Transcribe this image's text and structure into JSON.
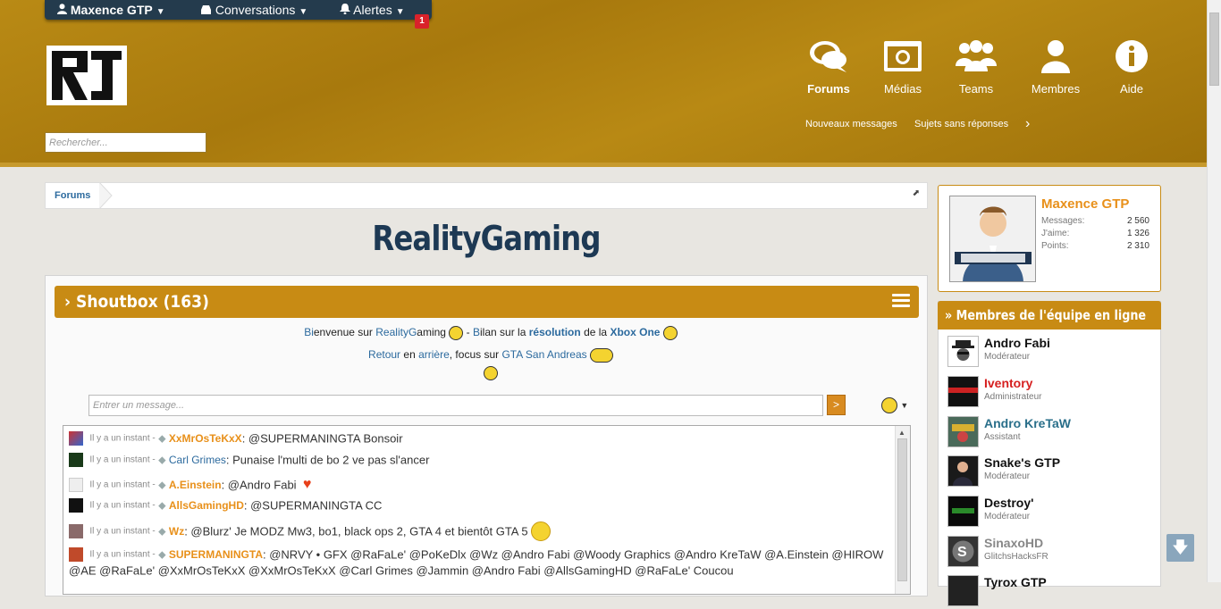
{
  "topbar": {
    "user": "Maxence GTP",
    "conversations": "Conversations",
    "alerts": "Alertes",
    "alert_count": "1"
  },
  "search": {
    "placeholder": "Rechercher..."
  },
  "nav": {
    "tabs": [
      {
        "label": "Forums",
        "icon": "chat-bubbles-icon"
      },
      {
        "label": "Médias",
        "icon": "camera-icon"
      },
      {
        "label": "Teams",
        "icon": "group-icon"
      },
      {
        "label": "Membres",
        "icon": "user-icon"
      },
      {
        "label": "Aide",
        "icon": "info-icon"
      }
    ],
    "sub": [
      "Nouveaux messages",
      "Sujets sans réponses"
    ]
  },
  "breadcrumb": {
    "label": "Forums"
  },
  "site_title": "RealityGaming",
  "shoutbox": {
    "title": "Shoutbox (163)",
    "announce1": {
      "p1a": "Bi",
      "p1b": "envenue sur ",
      "p1c": "Reality",
      "p1d": "G",
      "p1e": "aming ",
      "p2a": " - ",
      "p2b": "B",
      "p2c": "ilan sur la ",
      "p2d": "résolution",
      "p2e": " de la ",
      "p2f": "Xbox One"
    },
    "announce2": {
      "a": "Retour",
      "b": " en ",
      "c": "arrière",
      "d": ", focus sur ",
      "e": "GTA San Andreas"
    },
    "input_placeholder": "Entrer un message...",
    "send": ">",
    "messages": [
      {
        "time": "Il y a un instant -",
        "user": "XxMrOsTeKxX",
        "text": ": @SUPERMANINGTA Bonsoir"
      },
      {
        "time": "Il y a un instant -",
        "user": "Carl Grimes",
        "text": ": Punaise l'multi de bo 2 ve pas sl'ancer"
      },
      {
        "time": "Il y a un instant -",
        "user": "A.Einstein",
        "text": ": @Andro Fabi"
      },
      {
        "time": "Il y a un instant -",
        "user": "AllsGamingHD",
        "text": ": @SUPERMANINGTA CC"
      },
      {
        "time": "Il y a un instant -",
        "user": "Wz",
        "text": ": @Blurz' Je MODZ Mw3, bo1, black ops 2, GTA 4 et bientôt GTA 5"
      },
      {
        "time": "Il y a un instant -",
        "user": "SUPERMANINGTA",
        "text": ": @NRVY • GFX @RaFaLe' @PoKeDlx @Wz @Andro Fabi @Woody Graphics @Andro KreTaW @A.Einstein @HIROW",
        "text2": "@AE @RaFaLe' @XxMrOsTeKxX @XxMrOsTeKxX @Carl Grimes @Jammin @Andro Fabi @AllsGamingHD @RaFaLe' Coucou"
      }
    ]
  },
  "profile": {
    "name": "Maxence GTP",
    "stats": [
      {
        "label": "Messages:",
        "value": "2 560"
      },
      {
        "label": "J'aime:",
        "value": "1 326"
      },
      {
        "label": "Points:",
        "value": "2 310"
      }
    ]
  },
  "team": {
    "title": "Membres de l'équipe en ligne",
    "members": [
      {
        "name": "Andro Fabi",
        "role": "Modérateur",
        "color": "#111111"
      },
      {
        "name": "Iventory",
        "role": "Administrateur",
        "color": "#d61f1f"
      },
      {
        "name": "Andro KreTaW",
        "role": "Assistant",
        "color": "#2a6f8a"
      },
      {
        "name": "Snake's GTP",
        "role": "Modérateur",
        "color": "#111111"
      },
      {
        "name": "Destroy'",
        "role": "Modérateur",
        "color": "#111111"
      },
      {
        "name": "SinaxoHD",
        "role": "GlitchsHacksFR",
        "color": "#888888"
      },
      {
        "name": "Tyrox GTP",
        "role": "",
        "color": "#111111"
      }
    ]
  },
  "colors": {
    "accent": "#c88b14",
    "link": "#2c6a9e",
    "username": "#e8901a"
  }
}
